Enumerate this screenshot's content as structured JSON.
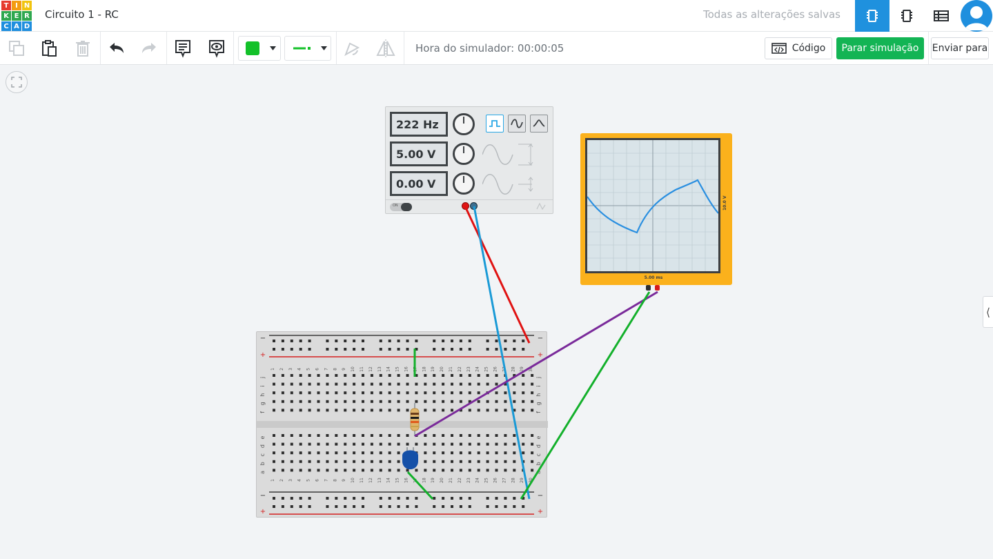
{
  "app": {
    "logo_letters": [
      "T",
      "I",
      "N",
      "K",
      "E",
      "R",
      "C",
      "A",
      "D"
    ],
    "logo_colors": [
      "#e63b2e",
      "#f39c12",
      "#f1c40f",
      "#2fa84f",
      "#2fa84f",
      "#2fa84f",
      "#1f8fde",
      "#1f8fde",
      "#1f8fde"
    ],
    "title": "Circuito 1 - RC",
    "save_status": "Todas as alterações salvas",
    "header_views": [
      {
        "icon": "circuit-view-icon",
        "active": true
      },
      {
        "icon": "component-list-icon",
        "active": false
      },
      {
        "icon": "table-view-icon",
        "active": false
      }
    ],
    "avatar_icon": "user-avatar-icon"
  },
  "toolbar": {
    "copy_icon": "copy-icon",
    "paste_icon": "paste-icon",
    "delete_icon": "trash-icon",
    "undo_icon": "undo-icon",
    "redo_icon": "redo-icon",
    "notes_icon": "notes-icon",
    "notes_visibility_icon": "notes-visibility-icon",
    "color_swatch": "#13c129",
    "wire_type_color": "#13c129",
    "rotate_icon": "rotate-icon",
    "mirror_icon": "mirror-icon",
    "sim_time": "Hora do simulador: 00:00:05",
    "code_label": "Código",
    "stop_label": "Parar simulação",
    "send_label": "Enviar para",
    "accent": "#13b454"
  },
  "function_generator": {
    "frequency": "222 Hz",
    "amplitude": "5.00 V",
    "offset": "0.00 V",
    "waveforms": [
      "square",
      "sine",
      "triangle"
    ],
    "selected_waveform": "square",
    "power_label": "ON"
  },
  "oscilloscope": {
    "time_per_div": "5.00 ms",
    "volts_per_div": "10.0 V"
  },
  "breadboard": {
    "columns": 30,
    "rows_top": [
      "j",
      "i",
      "h",
      "g",
      "f"
    ],
    "rows_bottom": [
      "e",
      "d",
      "c",
      "b",
      "a"
    ],
    "rail_minus": "−",
    "rail_plus": "+"
  }
}
